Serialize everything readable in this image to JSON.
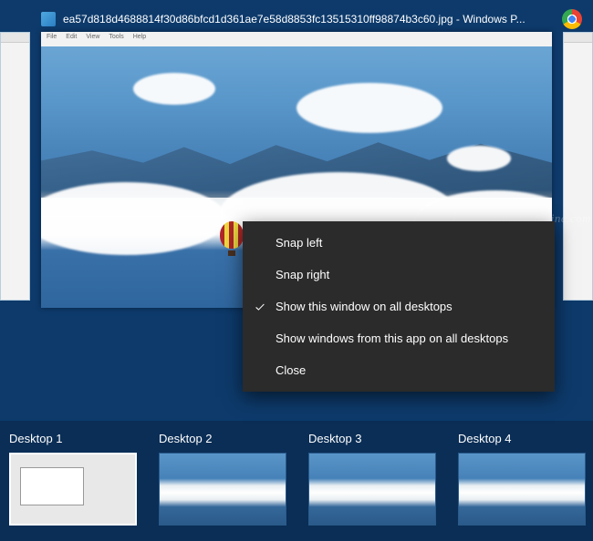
{
  "window": {
    "title": "ea57d818d4688814f30d86bfcd1d361ae7e58d8853fc13515310ff98874b3c60.jpg - Windows P..."
  },
  "app_menu": {
    "items": [
      "File",
      "Edit",
      "View",
      "Tools",
      "Help"
    ]
  },
  "watermark": "Winhelponline.com",
  "context_menu": {
    "items": [
      {
        "label": "Snap left",
        "checked": false
      },
      {
        "label": "Snap right",
        "checked": false
      },
      {
        "label": "Show this window on all desktops",
        "checked": true
      },
      {
        "label": "Show windows from this app on all desktops",
        "checked": false
      },
      {
        "label": "Close",
        "checked": false
      }
    ]
  },
  "desktops": {
    "items": [
      {
        "label": "Desktop 1",
        "active": true,
        "style": "wordpad"
      },
      {
        "label": "Desktop 2",
        "active": false,
        "style": "sky"
      },
      {
        "label": "Desktop 3",
        "active": false,
        "style": "sky"
      },
      {
        "label": "Desktop 4",
        "active": false,
        "style": "sky"
      }
    ]
  }
}
